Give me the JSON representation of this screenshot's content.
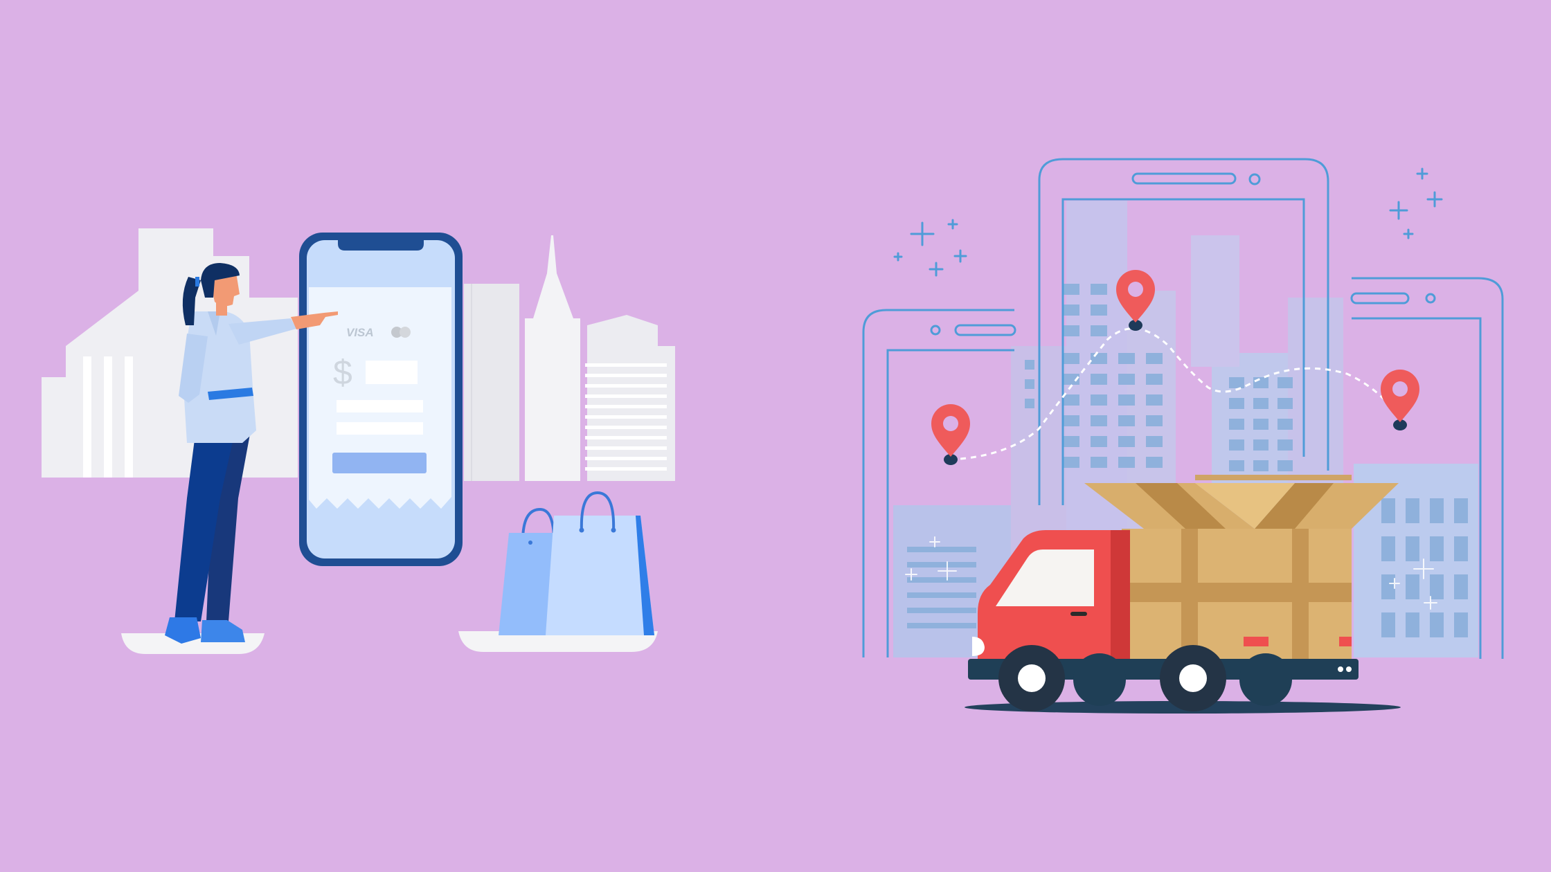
{
  "scene": {
    "background": "#dbb1e6",
    "left_illustration": "online-payment",
    "right_illustration": "delivery-tracking"
  },
  "payment": {
    "card_brand": "VISA",
    "currency_symbol": "$",
    "icons": [
      "woman-pointing",
      "smartphone-icon",
      "visa-logo",
      "mastercard-icon",
      "dollar-icon",
      "pay-button",
      "shopping-bag-icon",
      "city-skyline"
    ]
  },
  "delivery": {
    "location_pins": 3,
    "icons": [
      "phone-outline-icon",
      "location-pin-icon",
      "route-dashed-line",
      "delivery-truck-icon",
      "cardboard-box-icon",
      "sparkle-icon",
      "city-buildings"
    ]
  },
  "colors": {
    "phone_frame": "#1f4e93",
    "phone_screen": "#c6dcfb",
    "pin_red": "#ef5b5b",
    "truck_red": "#ef4f4f",
    "box_tan": "#dcb372",
    "outline_blue": "#4f9cd8",
    "skyline_gray": "#e8e8ee"
  }
}
